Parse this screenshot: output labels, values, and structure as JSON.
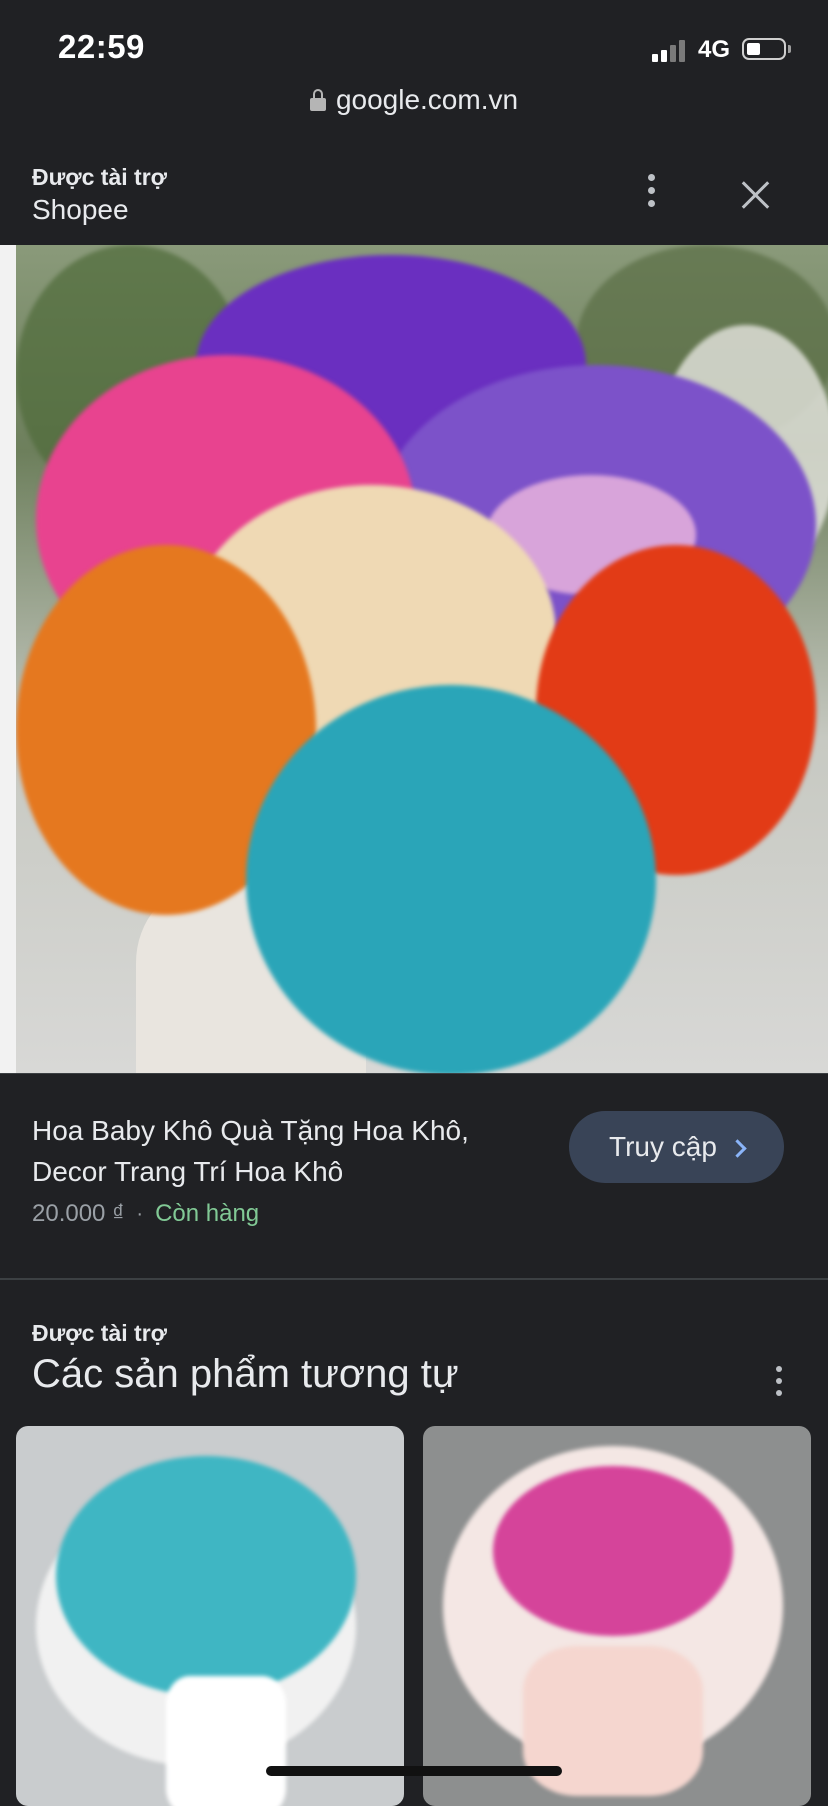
{
  "status_bar": {
    "time": "22:59",
    "network": "4G",
    "signal_bars": 2,
    "battery_level": 0.25
  },
  "browser": {
    "url": "google.com.vn"
  },
  "sponsor": {
    "label": "Được tài trợ",
    "name": "Shopee"
  },
  "product": {
    "title": "Hoa Baby Khô Quà Tặng Hoa Khô, Decor Trang Trí Hoa Khô",
    "price": "20.000 ₫",
    "separator": "·",
    "stock": "Còn hàng",
    "visit_label": "Truy cập"
  },
  "similar": {
    "sponsor_label": "Được tài trợ",
    "title": "Các sản phẩm tương tự"
  },
  "colors": {
    "background": "#202124",
    "accent": "#8ab4f8",
    "stock_green": "#81c995",
    "button": "#394457"
  },
  "icons": [
    "lock-icon",
    "more-vert-icon",
    "close-icon",
    "chevron-right-icon"
  ]
}
